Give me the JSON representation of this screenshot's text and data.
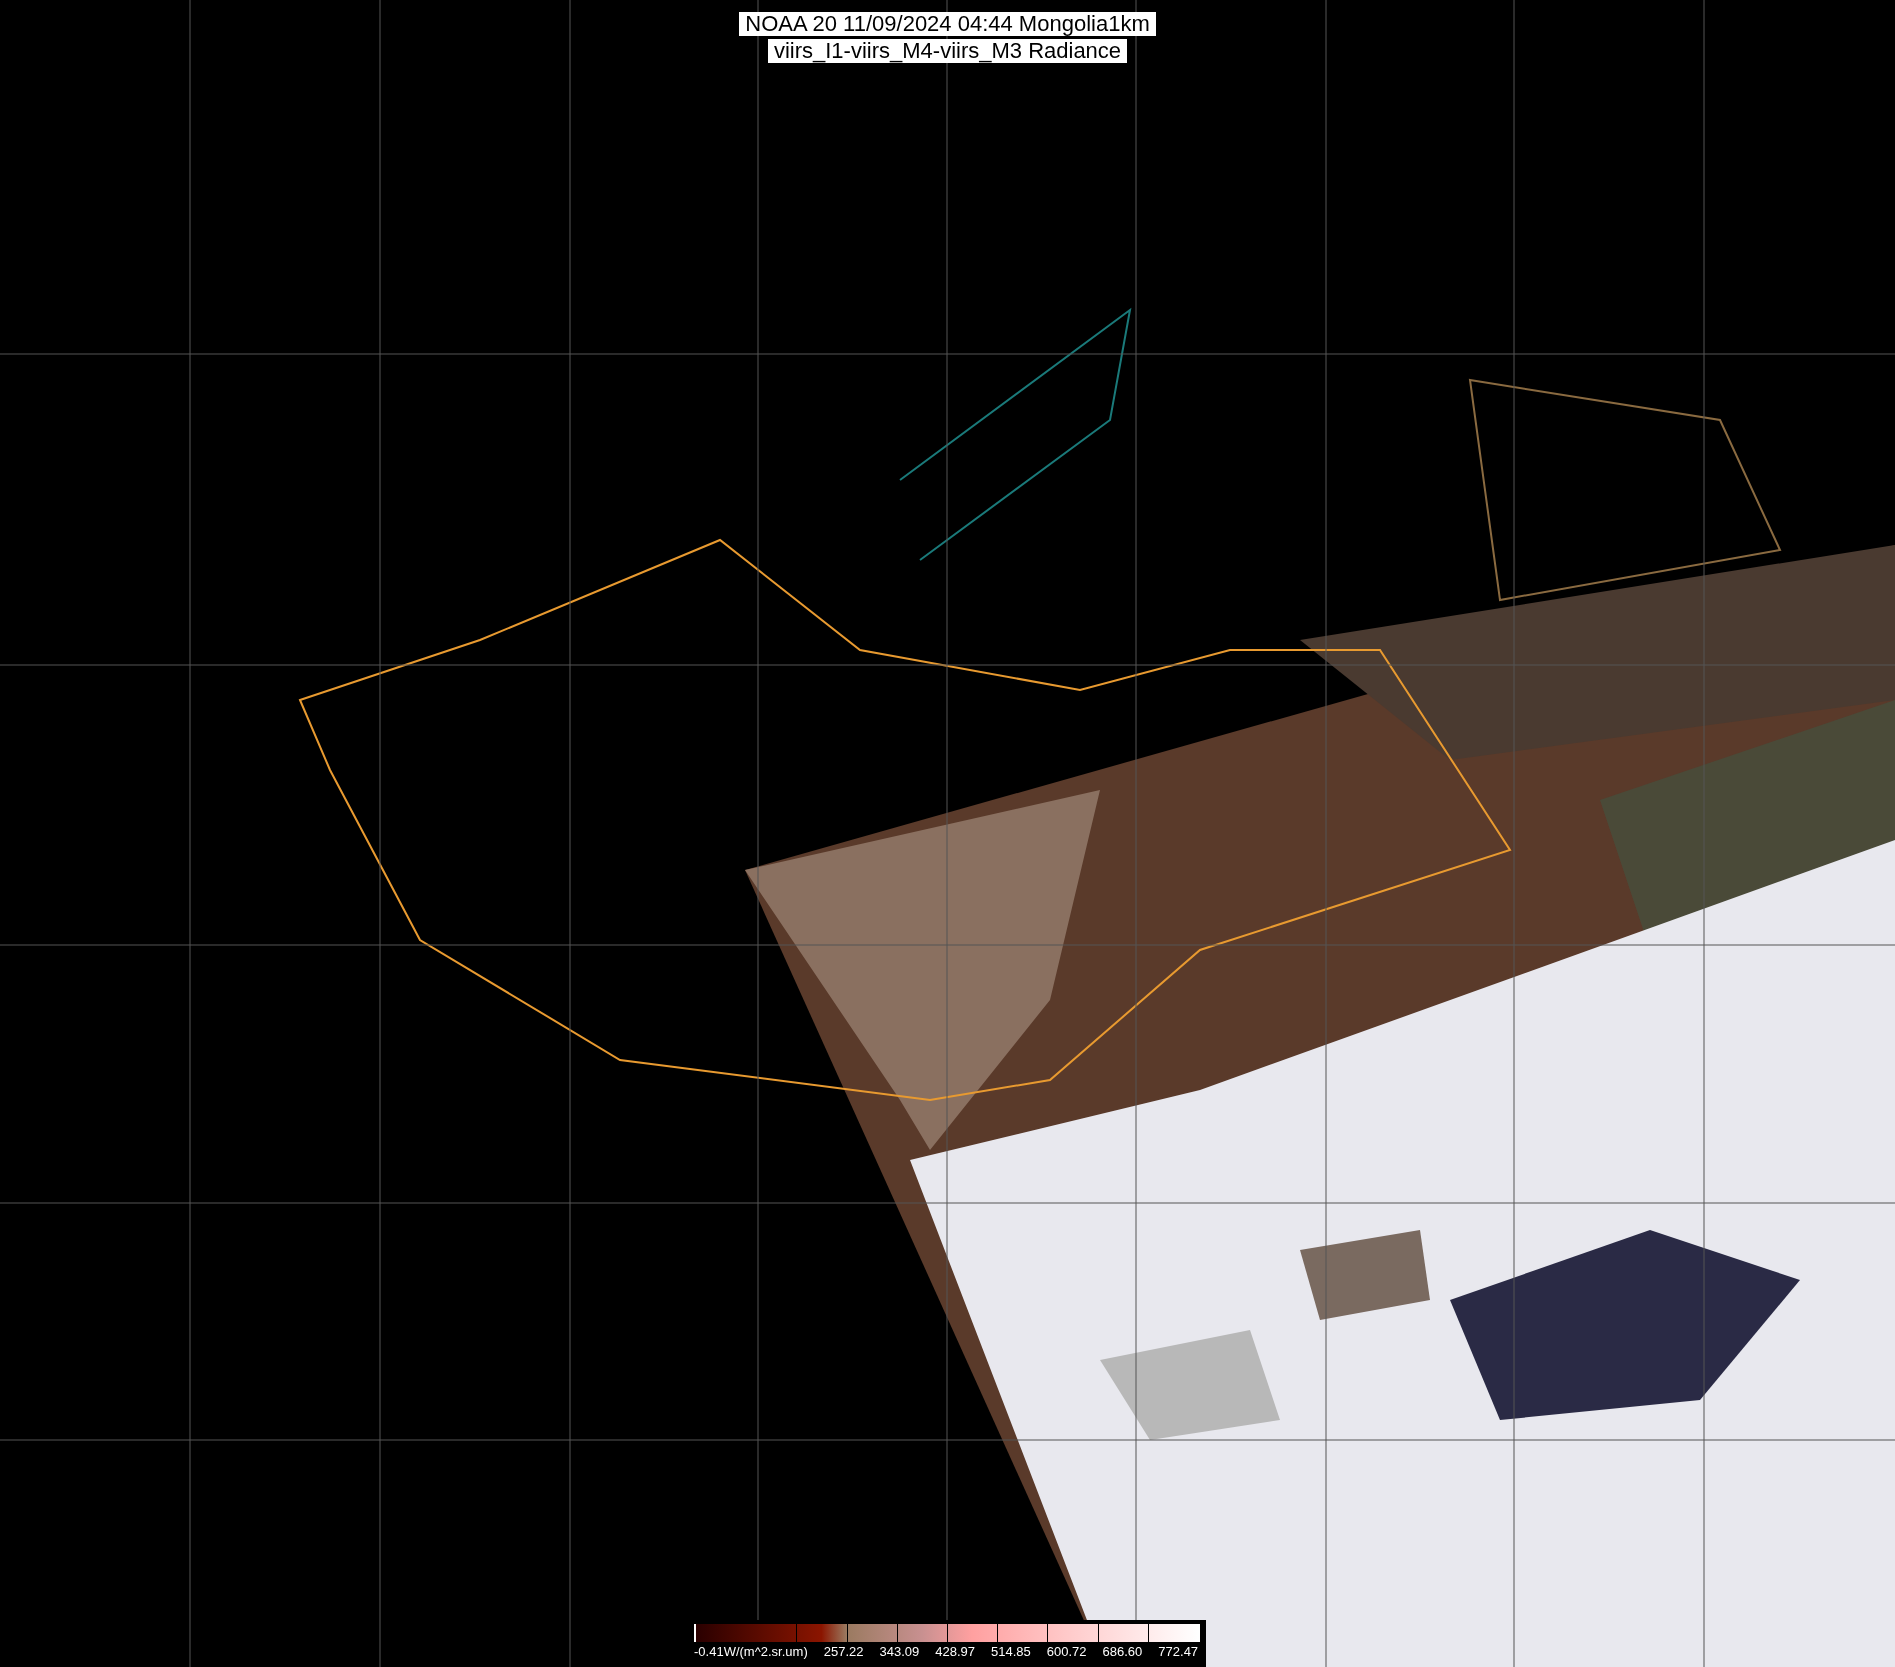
{
  "title": {
    "lines": [
      "NOAA 20 11/09/2024 04:44 Mongolia1km",
      "viirs_I1-viirs_M4-viirs_M3 Radiance"
    ]
  },
  "color_bar": {
    "labels": [
      "-0.41W/(m^2.sr.um)",
      "257.22",
      "343.09",
      "428.97",
      "514.85",
      "600.72",
      "686.60",
      "772.47"
    ]
  }
}
